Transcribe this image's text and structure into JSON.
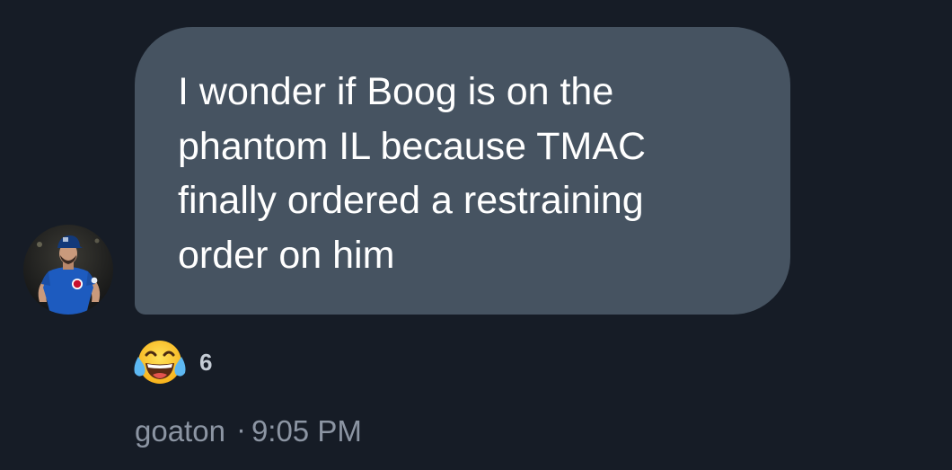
{
  "message": {
    "text": "I wonder if Boog is on the\nphantom IL because TMAC\nfinally ordered a restraining\norder on him"
  },
  "sender": {
    "avatar_icon": "baseball-player-avatar",
    "name": "goaton",
    "separator": "·",
    "time": "9:05 PM"
  },
  "reaction": {
    "emoji_icon": "face-with-tears-of-joy-icon",
    "count": "6"
  },
  "colors": {
    "background": "#161c26",
    "bubble": "#465361",
    "text": "#ffffff",
    "meta": "#8c95a3"
  }
}
